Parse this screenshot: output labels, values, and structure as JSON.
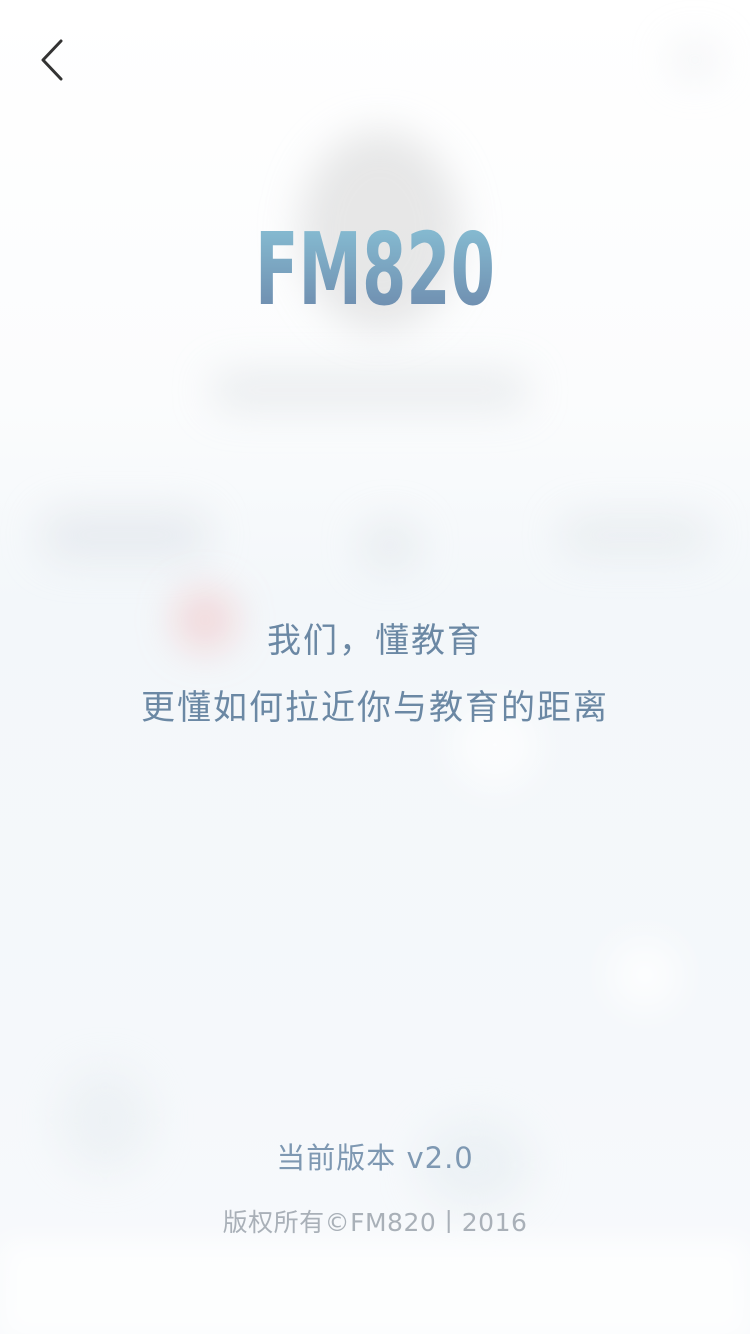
{
  "header": {
    "back_icon": "chevron-left-icon"
  },
  "logo": {
    "text": "FM820",
    "gradient_start": "#8ac4d8",
    "gradient_end": "#6a84a8"
  },
  "slogan": {
    "line1": "我们，懂教育",
    "line2": "更懂如何拉近你与教育的距离"
  },
  "footer": {
    "version": "当前版本 v2.0",
    "copyright": "版权所有©FM820丨2016"
  },
  "colors": {
    "slogan": "#6b88a4",
    "version": "#7e98b2",
    "copyright": "#a9b0b8",
    "back_icon": "#333333"
  }
}
